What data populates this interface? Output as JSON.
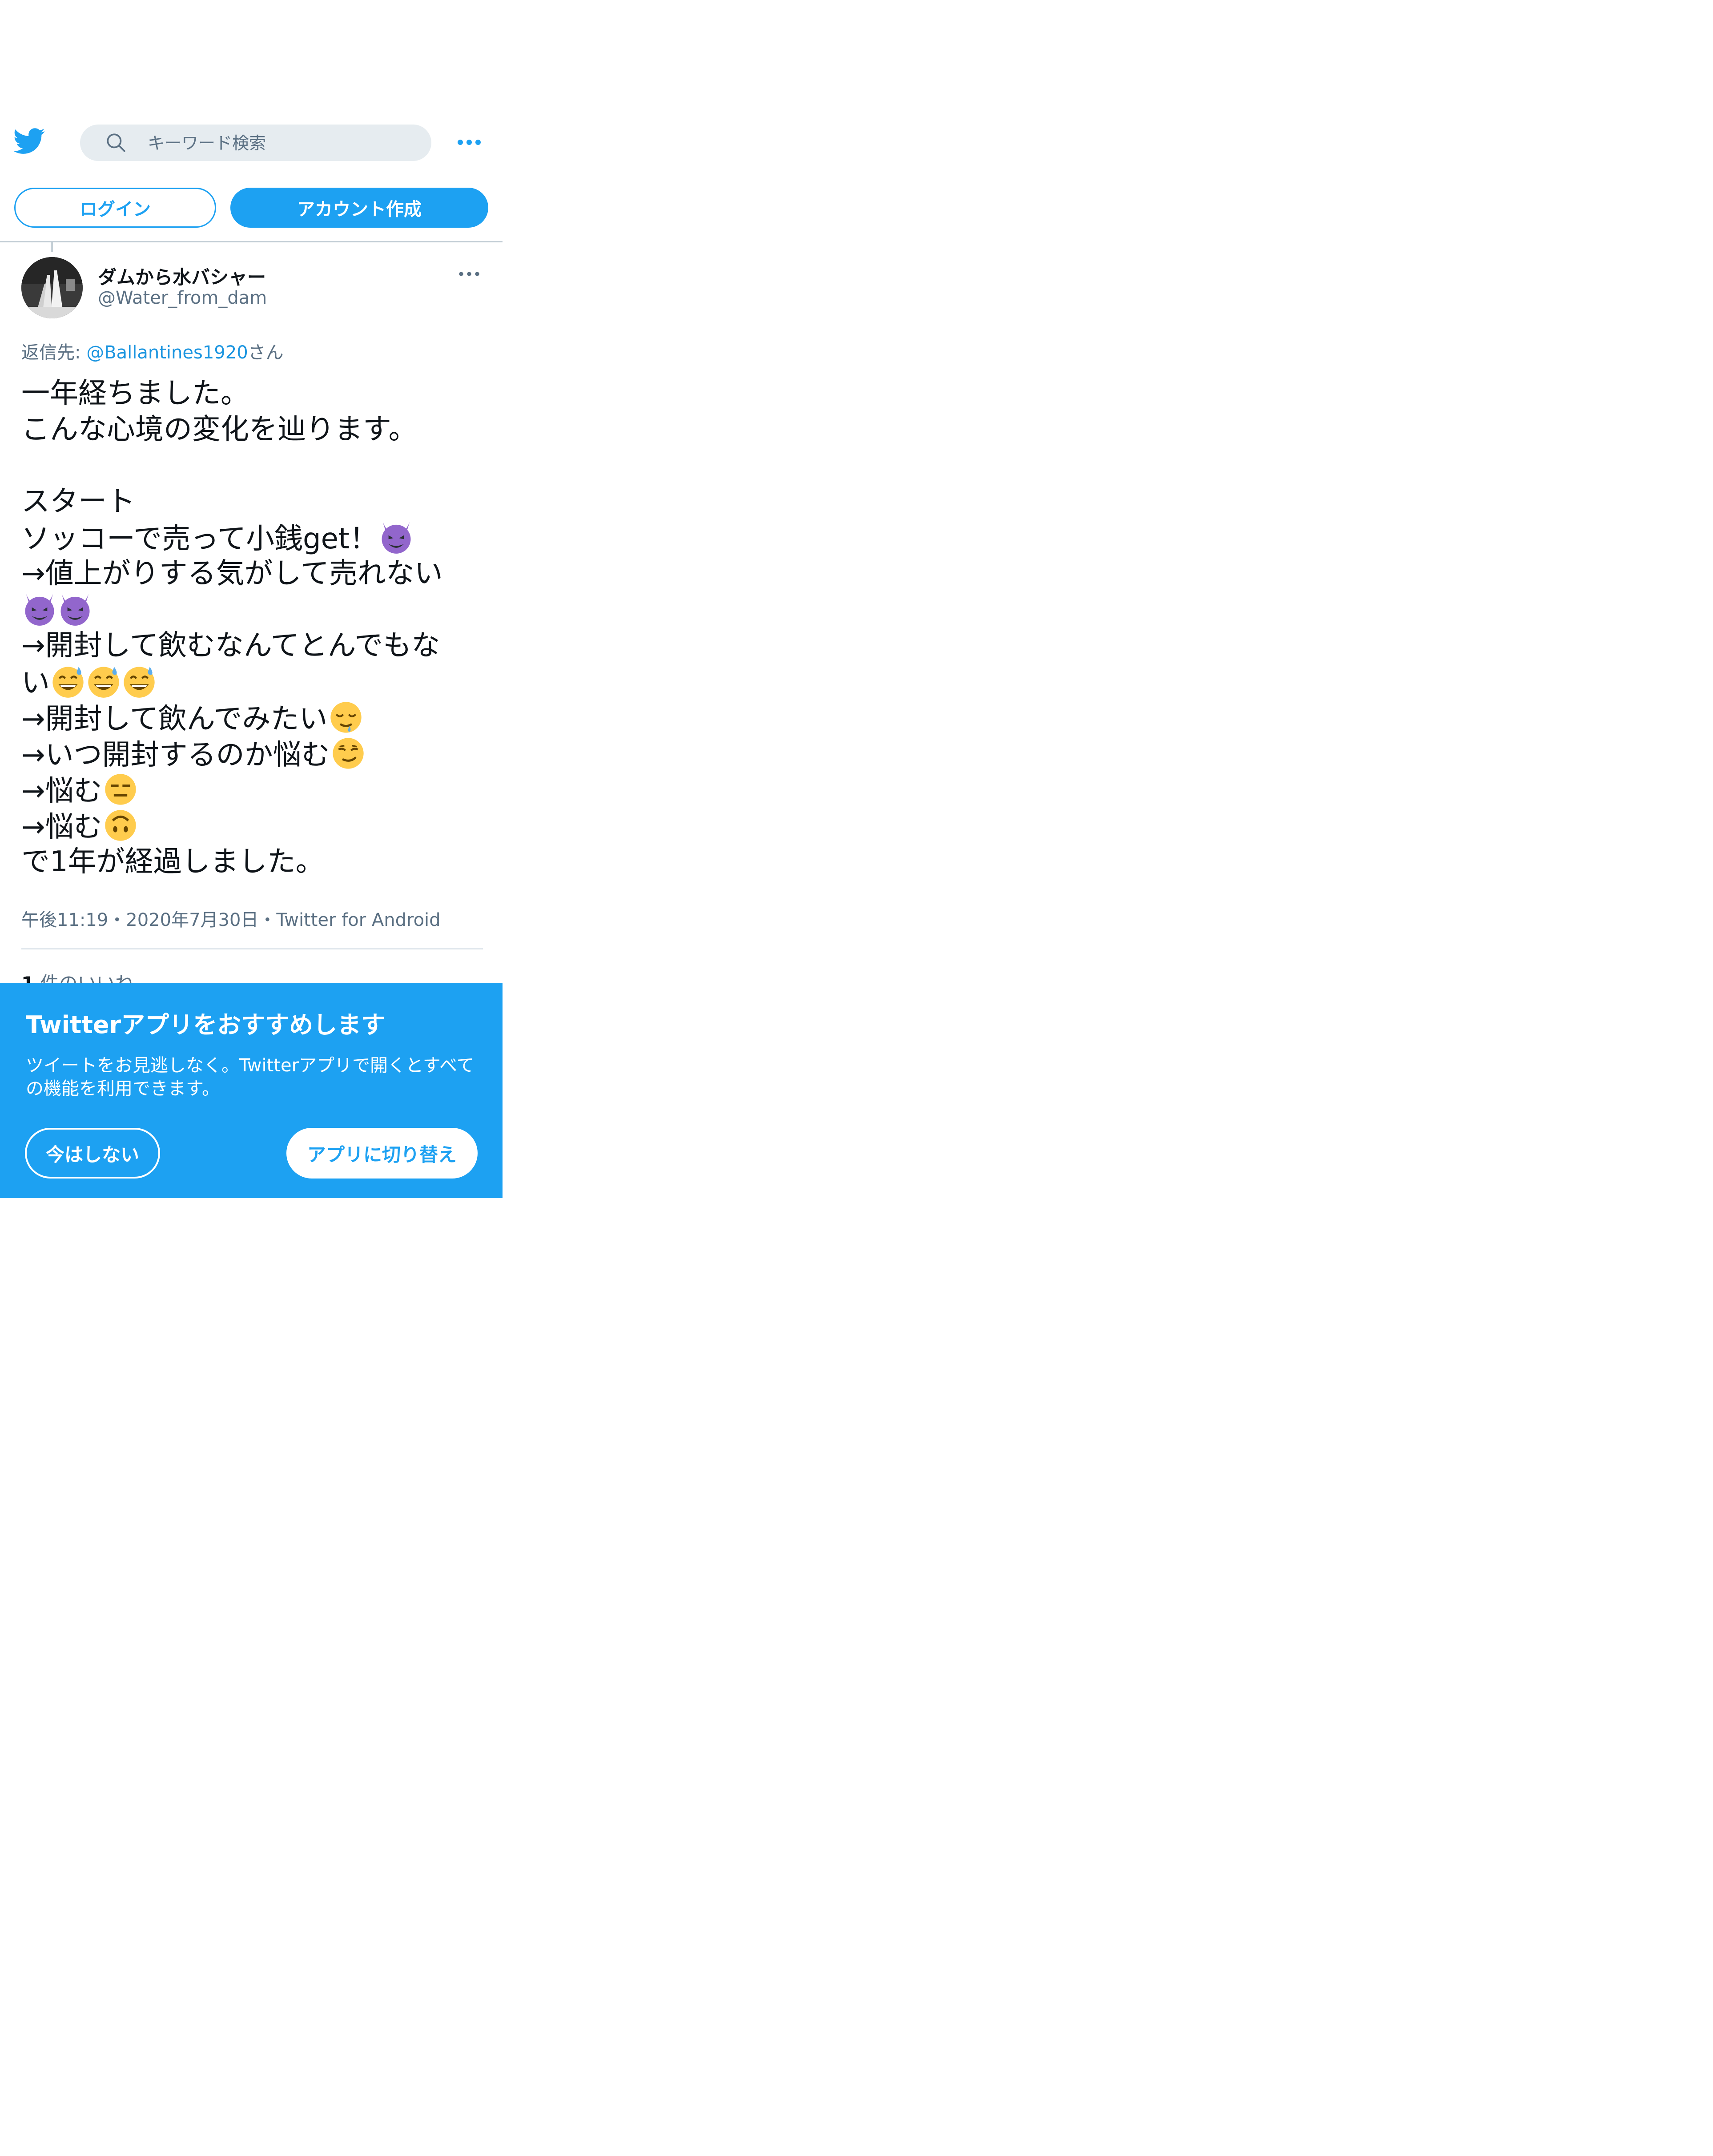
{
  "header": {
    "search_placeholder": "キーワード検索"
  },
  "auth": {
    "login_label": "ログイン",
    "signup_label": "アカウント作成"
  },
  "tweet": {
    "display_name": "ダムから水バシャー",
    "handle": "@Water_from_dam",
    "reply_prefix": "返信先: ",
    "reply_mention": "@Ballantines1920",
    "reply_suffix": "さん",
    "lines": [
      "一年経ちました。",
      "こんな心境の変化を辿ります。",
      "",
      "スタート",
      "ソッコーで売って小銭get！",
      "→値上がりする気がして売れない",
      "",
      "→開封して飲むなんてとんでもな",
      "い",
      "→開封して飲んでみたい",
      "→いつ開封するのか悩む",
      "→悩む",
      "→悩む",
      "で1年が経過しました。"
    ],
    "meta": "午後11:19・2020年7月30日・Twitter for Android",
    "likes_count": "1",
    "likes_label": " 件のいいね"
  },
  "banner": {
    "title": "Twitterアプリをおすすめします",
    "text": "ツイートをお見逃しなく。Twitterアプリで開くとすべての機能を利用できます。",
    "not_now_label": "今はしない",
    "switch_label": "アプリに切り替え"
  },
  "colors": {
    "accent": "#1da1f2",
    "secondary_text": "#5b7083",
    "search_bg": "#e6ecf0"
  },
  "icons": [
    "twitter-bird-icon",
    "search-icon",
    "more-horizontal-icon",
    "smiling-imp-emoji",
    "grinning-sweat-emoji",
    "relieved-drool-emoji",
    "smirk-emoji",
    "expressionless-emoji",
    "upside-down-emoji"
  ]
}
